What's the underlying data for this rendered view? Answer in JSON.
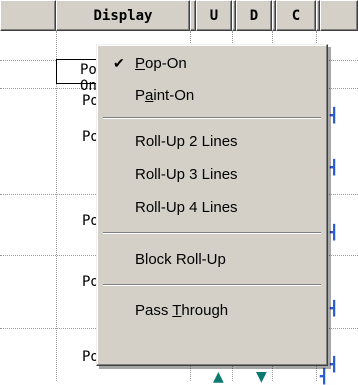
{
  "columns": [
    "Display",
    "U",
    "D",
    "C"
  ],
  "rows": [
    {
      "display": "Pop-On"
    },
    {
      "display": "Po"
    },
    {
      "display": "Po"
    },
    {
      "display": "Po"
    },
    {
      "display": "Po"
    },
    {
      "display": "Po"
    }
  ],
  "context_menu": {
    "items": [
      {
        "label": "Pop-On",
        "checked": true,
        "mnemonic": "P"
      },
      {
        "label": "Paint-On",
        "checked": false,
        "mnemonic": "a"
      },
      {
        "separator": true
      },
      {
        "label": "Roll-Up 2 Lines",
        "checked": false
      },
      {
        "label": "Roll-Up 3 Lines",
        "checked": false
      },
      {
        "label": "Roll-Up 4 Lines",
        "checked": false
      },
      {
        "separator": true
      },
      {
        "label": "Block Roll-Up",
        "checked": false
      },
      {
        "separator": true
      },
      {
        "label": "Pass Through",
        "checked": false,
        "mnemonic": "T"
      }
    ],
    "check_glyph": "✔"
  }
}
